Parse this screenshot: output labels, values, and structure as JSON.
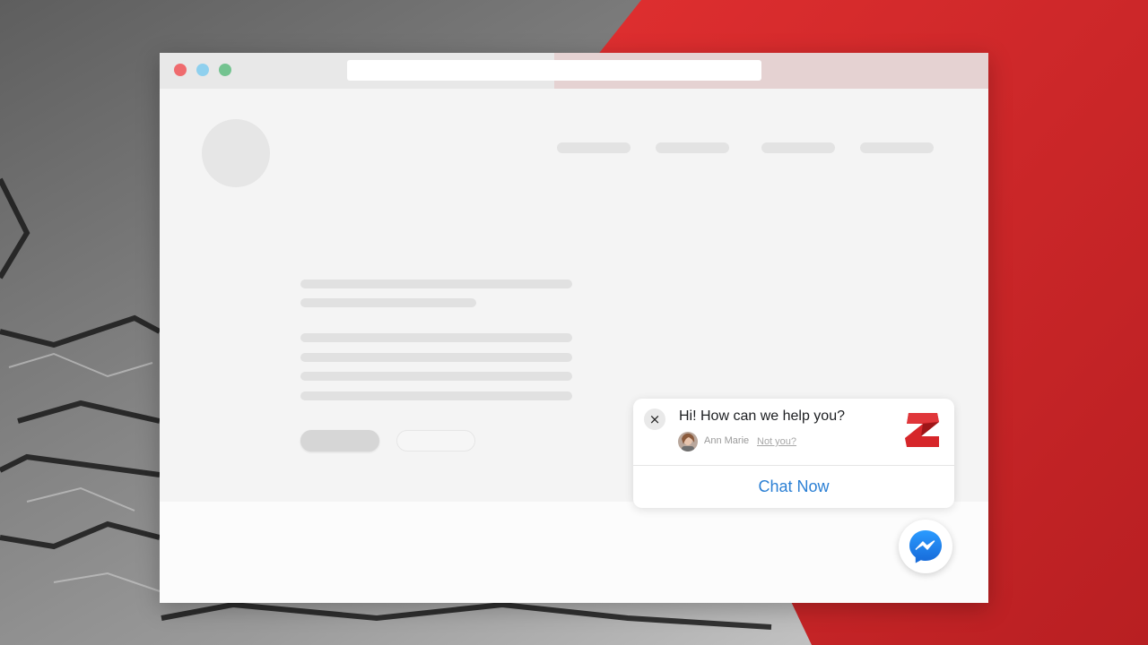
{
  "colors": {
    "background_gray": "#8a8a8a",
    "background_red": "#cc2a2a",
    "accent_blue": "#2a7fd4",
    "brand_red": "#d6262a"
  },
  "browser": {
    "controls": [
      "close",
      "minimize",
      "maximize"
    ]
  },
  "chat_widget": {
    "close_icon": "×",
    "greeting": "Hi! How can we help you?",
    "agent_name": "Ann Marie",
    "not_you_link": "Not you?",
    "chat_now_button": "Chat Now",
    "brand_icon": "z-logo-icon",
    "messenger_icon": "messenger-icon"
  }
}
